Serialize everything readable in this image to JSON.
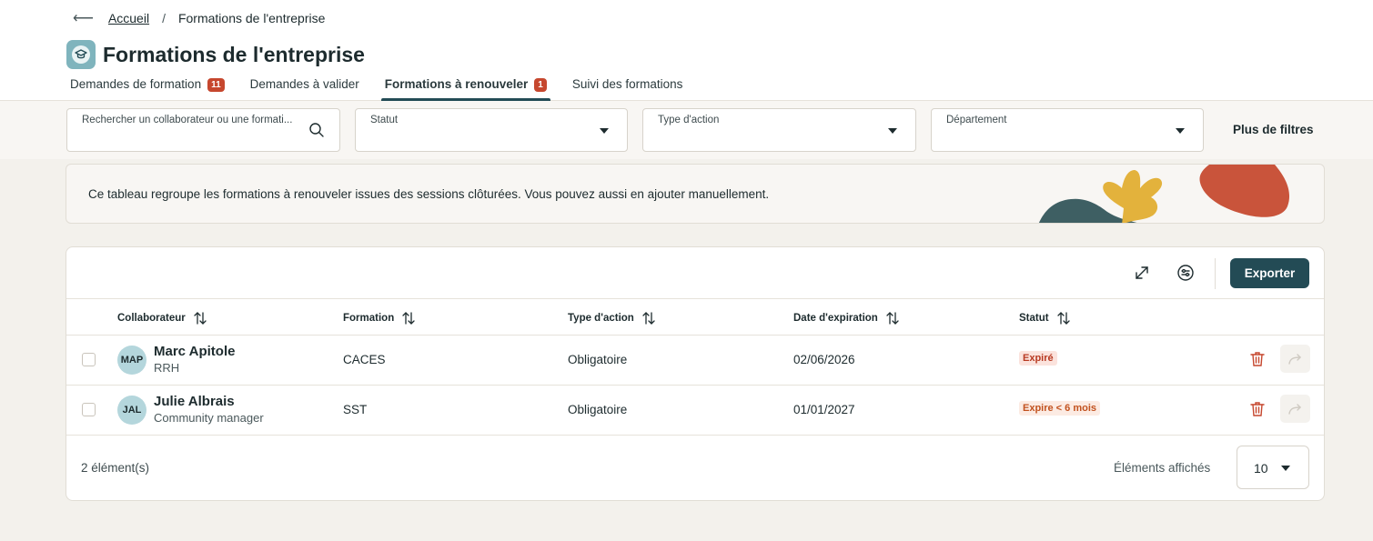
{
  "breadcrumb": {
    "back_icon": "arrow-left-icon",
    "home": "Accueil",
    "separator": "/",
    "current": "Formations de l'entreprise"
  },
  "page": {
    "title": "Formations de l'entreprise",
    "icon": "graduation-cap-icon"
  },
  "tabs": [
    {
      "label": "Demandes de formation",
      "badge": "11",
      "active": false
    },
    {
      "label": "Demandes à valider",
      "badge": "",
      "active": false
    },
    {
      "label": "Formations à renouveler",
      "badge": "1",
      "active": true
    },
    {
      "label": "Suivi des formations",
      "badge": "",
      "active": false
    }
  ],
  "filters": {
    "search_placeholder": "Rechercher un collaborateur ou une formati...",
    "status_label": "Statut",
    "action_type_label": "Type d'action",
    "department_label": "Département",
    "more_filters": "Plus de filtres"
  },
  "banner": {
    "text": "Ce tableau regroupe les formations à renouveler issues des sessions clôturées. Vous pouvez aussi en ajouter manuellement."
  },
  "toolbar": {
    "export_label": "Exporter",
    "expand_icon": "expand-icon",
    "columns_icon": "settings-sliders-icon"
  },
  "table": {
    "columns": [
      "Collaborateur",
      "Formation",
      "Type d'action",
      "Date d'expiration",
      "Statut"
    ],
    "rows": [
      {
        "initials": "MAP",
        "name": "Marc Apitole",
        "role": "RRH",
        "formation": "CACES",
        "action_type": "Obligatoire",
        "expiration": "02/06/2026",
        "status": "Expiré"
      },
      {
        "initials": "JAL",
        "name": "Julie Albrais",
        "role": "Community manager",
        "formation": "SST",
        "action_type": "Obligatoire",
        "expiration": "01/01/2027",
        "status": "Expire < 6 mois"
      }
    ]
  },
  "footer": {
    "count": "2 élément(s)",
    "per_page_label": "Éléments affichés",
    "per_page_value": "10"
  },
  "colors": {
    "primary": "#234b55",
    "badge": "#c6472e",
    "expired": "#b83a22",
    "background": "#f3f1ec"
  }
}
